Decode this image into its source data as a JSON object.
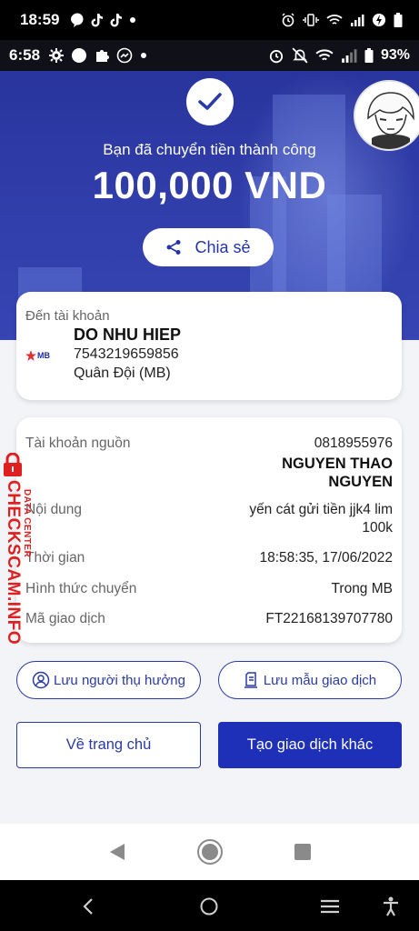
{
  "outer_status": {
    "time": "18:59"
  },
  "inner_status": {
    "time": "6:58",
    "battery": "93%"
  },
  "hero": {
    "success_text": "Bạn đã chuyển tiền thành công",
    "amount": "100,000 VND",
    "share_label": "Chia sẻ"
  },
  "recipient": {
    "label": "Đến tài khoản",
    "bank_logo_text": "MB",
    "name": "DO NHU HIEP",
    "account": "7543219659856",
    "bank": "Quân Đội (MB)"
  },
  "details": {
    "source_label": "Tài khoản nguồn",
    "source_account": "0818955976",
    "source_name_1": "NGUYEN THAO",
    "source_name_2": "NGUYEN",
    "content_label": "Nội dung",
    "content_line_1": "yến cát gửi tiền jjk4 lim",
    "content_line_2": "100k",
    "time_label": "Thời gian",
    "time_value": "18:58:35, 17/06/2022",
    "type_label": "Hình thức chuyển",
    "type_value": "Trong MB",
    "code_label": "Mã giao dịch",
    "code_value": "FT22168139707780"
  },
  "actions": {
    "save_beneficiary": "Lưu người thụ hưởng",
    "save_template": "Lưu mẫu giao dịch",
    "home": "Về trang chủ",
    "new_transaction": "Tạo giao dịch khác"
  },
  "watermark": {
    "brand": "CHECKSCAM.INFO",
    "sub": "DATA CENTER"
  },
  "colors": {
    "primary": "#1e2fb8",
    "hero": "#2f3ca8",
    "watermark": "#e02020"
  }
}
